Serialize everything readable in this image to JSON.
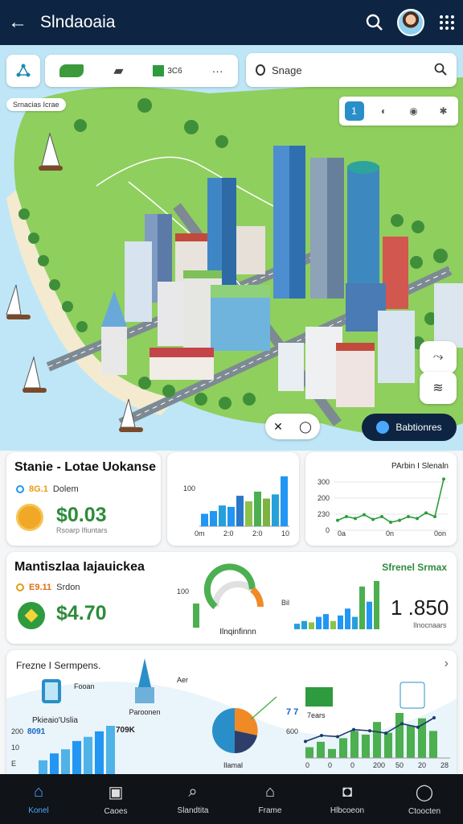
{
  "header": {
    "title": "Slndaoaia"
  },
  "map": {
    "toolbar": {
      "tool3_label": "3C6",
      "more": "···"
    },
    "search_placeholder": "Snage",
    "area_label": "Srnacias Icrae",
    "nav_button_label": "Babtionres"
  },
  "card_status": {
    "title": "Stanie - Lotae Uokanse",
    "line1_value": "8G.1",
    "line1_label": "Dolem",
    "price": "$0.03",
    "sublabel": "Rsoarp Ifiuntars"
  },
  "chart_bars_small": {
    "chart_data": {
      "type": "bar",
      "y_tick": "100",
      "xticks": [
        "0m",
        "2:0",
        "2:0",
        "10"
      ],
      "values": [
        18,
        22,
        30,
        28,
        44,
        36,
        50,
        40,
        46,
        72
      ],
      "colors": [
        "#2196f3",
        "#2196f3",
        "#26a0da",
        "#2196f3",
        "#2a78c8",
        "#8bc34a",
        "#4caf50",
        "#7cb342",
        "#26a0da",
        "#2196f3"
      ]
    }
  },
  "chart_line_small": {
    "chart_data": {
      "type": "line",
      "title": "PArbin I Slenaln",
      "yticks": [
        "300",
        "200",
        "230",
        "0"
      ],
      "xticks": [
        "0a",
        "0n",
        "0on"
      ],
      "values": [
        8,
        12,
        10,
        14,
        9,
        12,
        6,
        8,
        12,
        10,
        16,
        12,
        52
      ]
    }
  },
  "card_summary": {
    "title": "Mantiszlaa Iajauickea",
    "line1_value": "E9.11",
    "line1_label": "Srdon",
    "price": "$4.70",
    "gauge_label": "Ilnqinfinnn",
    "gauge_tick": "100",
    "gauge_value": 0.72,
    "status_label": "Sfrenel Srmax",
    "mini_tick": "Bil",
    "big_value": "1 .850",
    "big_label": "Ilnocnaars",
    "chart_data": {
      "type": "bar",
      "values": [
        8,
        12,
        10,
        18,
        22,
        12,
        20,
        30,
        18,
        62,
        40,
        70
      ],
      "colors": [
        "#26a0da",
        "#26a0da",
        "#8bc34a",
        "#2196f3",
        "#2196f3",
        "#8bc34a",
        "#2196f3",
        "#2196f3",
        "#26a0da",
        "#4caf50",
        "#2196f3",
        "#4caf50"
      ]
    }
  },
  "card_bottom": {
    "title": "Frezne I Sermpens.",
    "label_device": "Fooan",
    "label_tower": "Paroonen",
    "label_phone": "Pkieaio'Uslia",
    "value_8091": "8091",
    "value_709k": "709K",
    "label_aer": "Aer",
    "label_year": "7ears",
    "pie_label": "Ilamal",
    "chart_tick": "7 7",
    "chart_val": "600",
    "xticks": [
      "0",
      "0",
      "0",
      "200",
      "50",
      "20",
      "28"
    ],
    "left_chart": {
      "chart_data": {
        "type": "bar",
        "yticks": [
          "200",
          "10",
          "E"
        ],
        "values": [
          20,
          30,
          36,
          48,
          54,
          62,
          70
        ]
      }
    },
    "right_chart": {
      "chart_data": {
        "type": "bar",
        "values": [
          12,
          18,
          10,
          22,
          30,
          26,
          40,
          28,
          50,
          36,
          44,
          30
        ],
        "line": [
          20,
          30,
          28,
          40,
          38,
          34,
          50,
          44,
          60
        ]
      }
    }
  },
  "bottom_nav": [
    {
      "label": "Konel",
      "icon": "home-icon"
    },
    {
      "label": "Caoes",
      "icon": "cases-icon"
    },
    {
      "label": "Slandtita",
      "icon": "search-icon"
    },
    {
      "label": "Frame",
      "icon": "store-icon"
    },
    {
      "label": "Hlbcoeon",
      "icon": "bag-icon"
    },
    {
      "label": "Ctoocten",
      "icon": "profile-icon"
    }
  ],
  "colors": {
    "header": "#0d2442",
    "accent": "#2a8fc8",
    "green": "#2e9b3e",
    "blue": "#2196f3"
  }
}
